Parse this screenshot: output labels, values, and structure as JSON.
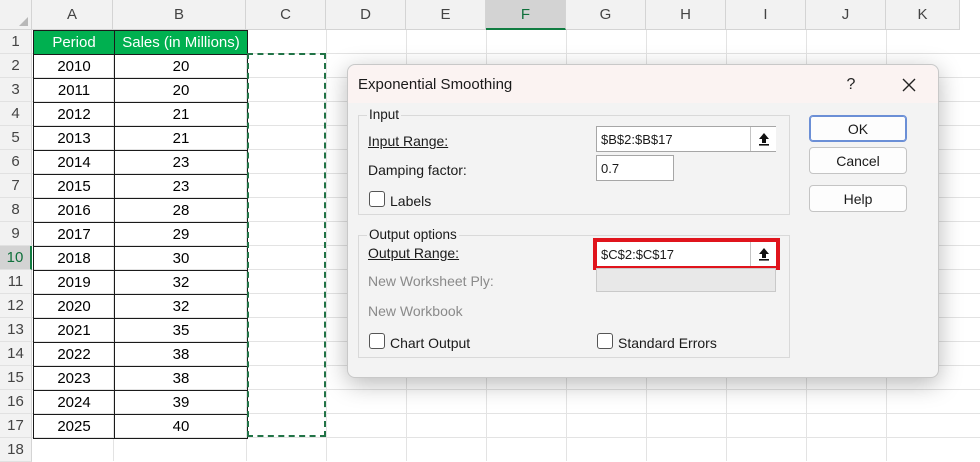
{
  "sheet": {
    "columns": [
      "A",
      "B",
      "C",
      "D",
      "E",
      "F",
      "G",
      "H",
      "I",
      "J",
      "K"
    ],
    "active_column": "F",
    "rows": [
      "1",
      "2",
      "3",
      "4",
      "5",
      "6",
      "7",
      "8",
      "9",
      "10",
      "11",
      "12",
      "13",
      "14",
      "15",
      "16",
      "17",
      "18"
    ],
    "active_row": "10",
    "table_header": [
      "Period",
      "Sales (in Millions)"
    ],
    "table_rows": [
      [
        "2010",
        "20"
      ],
      [
        "2011",
        "20"
      ],
      [
        "2012",
        "21"
      ],
      [
        "2013",
        "21"
      ],
      [
        "2014",
        "23"
      ],
      [
        "2015",
        "23"
      ],
      [
        "2016",
        "28"
      ],
      [
        "2017",
        "29"
      ],
      [
        "2018",
        "30"
      ],
      [
        "2019",
        "32"
      ],
      [
        "2020",
        "32"
      ],
      [
        "2021",
        "35"
      ],
      [
        "2022",
        "38"
      ],
      [
        "2023",
        "38"
      ],
      [
        "2024",
        "39"
      ],
      [
        "2025",
        "40"
      ]
    ],
    "header_color": "#00b050",
    "accent_color": "#107c41"
  },
  "dialog": {
    "title": "Exponential Smoothing",
    "help_glyph": "?",
    "close_icon": "close-icon",
    "input_group": {
      "title": "Input",
      "input_range_label": "Input Range:",
      "input_range_value": "$B$2:$B$17",
      "damping_label": "Damping factor:",
      "damping_value": "0.7",
      "labels_checkbox": "Labels",
      "labels_checked": false
    },
    "output_group": {
      "title": "Output options",
      "output_range_label": "Output Range:",
      "output_range_value": "$C$2:$C$17",
      "new_worksheet_label": "New Worksheet Ply:",
      "new_workbook_label": "New Workbook",
      "chart_output_label": "Chart Output",
      "chart_output_checked": false,
      "standard_errors_label": "Standard Errors",
      "standard_errors_checked": false
    },
    "buttons": {
      "ok": "OK",
      "cancel": "Cancel",
      "help": "Help"
    },
    "highlight_color": "#e0141c"
  }
}
